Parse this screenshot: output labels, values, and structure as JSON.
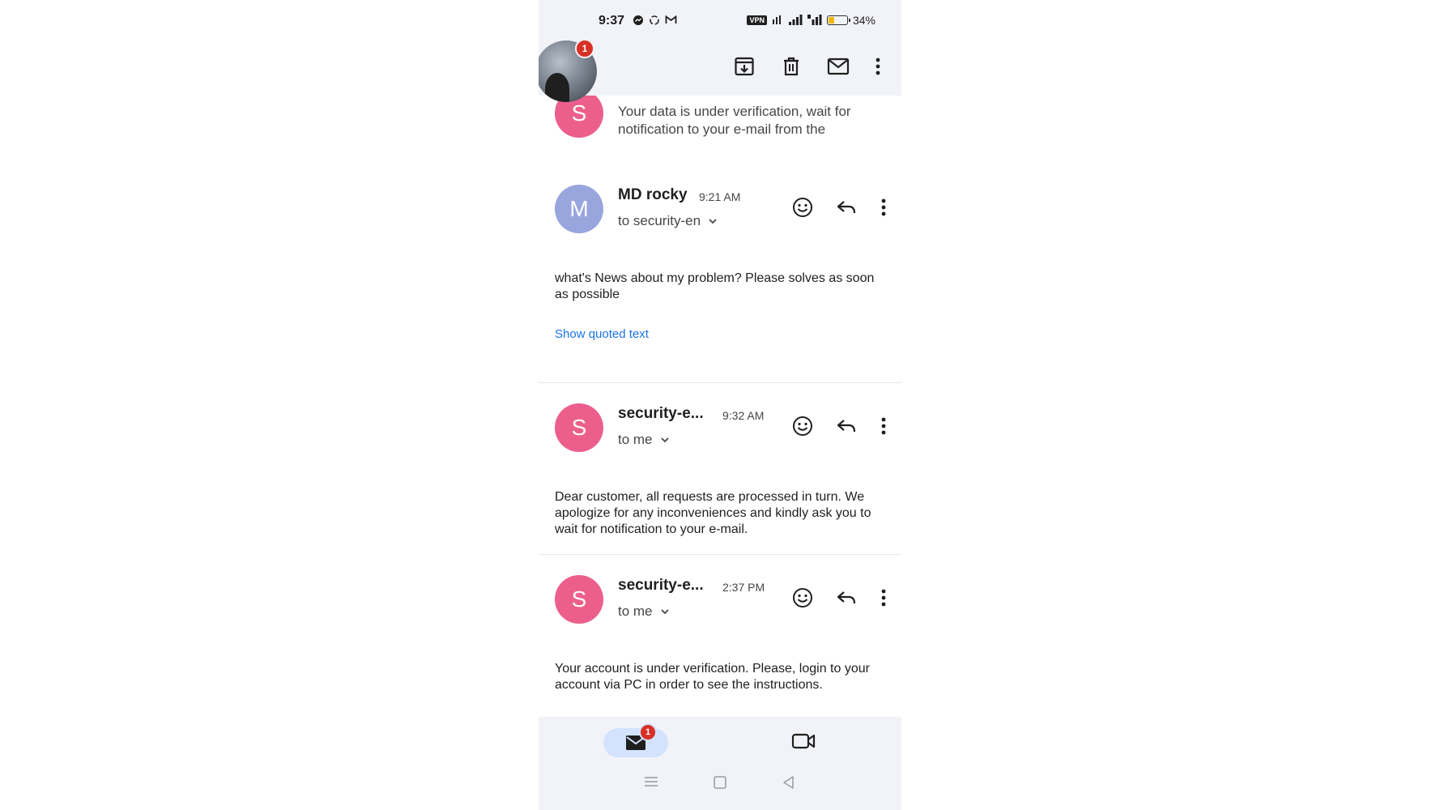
{
  "status_bar": {
    "time": "9:37",
    "vpn": "VPN",
    "battery": "34%",
    "battery_level": 0.34
  },
  "app_bar": {
    "avatar_badge": "1",
    "icons": [
      "archive-icon",
      "delete-icon",
      "mark-unread-icon",
      "more-vert-icon"
    ]
  },
  "thread": {
    "partial": {
      "avatar_letter": "S",
      "snippet": "Your data is under verification, wait for notification to your e-mail from the"
    },
    "messages": [
      {
        "avatar_letter": "M",
        "sender": "MD rocky",
        "time": "9:21 AM",
        "to": "to security-en",
        "body": "what's News about my problem? Please solves as soon as possible",
        "quoted": "Show quoted text"
      },
      {
        "avatar_letter": "S",
        "sender": "security-e...",
        "time": "9:32 AM",
        "to": "to me",
        "body": "Dear customer, all requests are processed in turn. We apologize for any inconveniences and kindly ask you to wait for notification to your e-mail."
      },
      {
        "avatar_letter": "S",
        "sender": "security-e...",
        "time": "2:37 PM",
        "to": "to me",
        "body": "Your account is under verification. Please, login to your account via PC in order to see the instructions."
      }
    ]
  },
  "bottom_nav": {
    "mail_badge": "1"
  },
  "colors": {
    "accent": "#1a73e8",
    "avatar_pink": "#ec5f8c",
    "avatar_lavender": "#99a5dd",
    "badge_red": "#d93025"
  }
}
